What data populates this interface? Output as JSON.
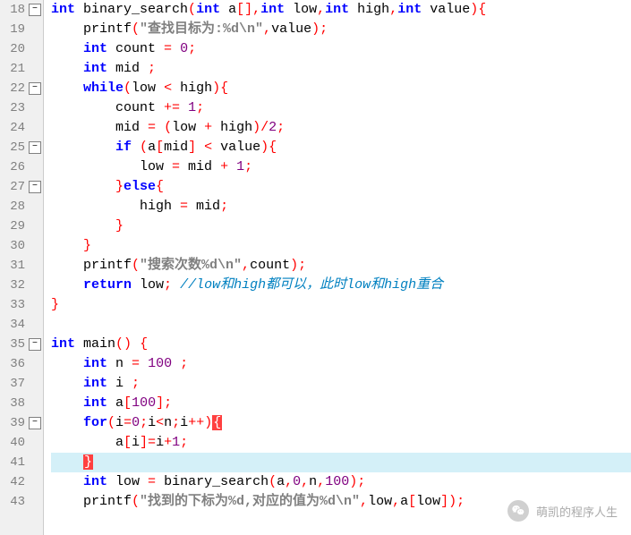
{
  "lines": [
    {
      "n": 18,
      "fold": "minus",
      "hl": false,
      "tokens": [
        [
          "kw",
          "int"
        ],
        [
          "plain",
          " binary_search"
        ],
        [
          "op",
          "("
        ],
        [
          "kw",
          "int"
        ],
        [
          "plain",
          " a"
        ],
        [
          "op",
          "[],"
        ],
        [
          "kw",
          "int"
        ],
        [
          "plain",
          " low"
        ],
        [
          "op",
          ","
        ],
        [
          "kw",
          "int"
        ],
        [
          "plain",
          " high"
        ],
        [
          "op",
          ","
        ],
        [
          "kw",
          "int"
        ],
        [
          "plain",
          " value"
        ],
        [
          "op",
          "){"
        ]
      ]
    },
    {
      "n": 19,
      "fold": "",
      "hl": false,
      "tokens": [
        [
          "plain",
          "    printf"
        ],
        [
          "op",
          "("
        ],
        [
          "str",
          "\"查找目标为:%d\\n\""
        ],
        [
          "op",
          ","
        ],
        [
          "plain",
          "value"
        ],
        [
          "op",
          ");"
        ]
      ]
    },
    {
      "n": 20,
      "fold": "",
      "hl": false,
      "tokens": [
        [
          "plain",
          "    "
        ],
        [
          "kw",
          "int"
        ],
        [
          "plain",
          " count "
        ],
        [
          "op",
          "="
        ],
        [
          "plain",
          " "
        ],
        [
          "num",
          "0"
        ],
        [
          "op",
          ";"
        ]
      ]
    },
    {
      "n": 21,
      "fold": "",
      "hl": false,
      "tokens": [
        [
          "plain",
          "    "
        ],
        [
          "kw",
          "int"
        ],
        [
          "plain",
          " mid "
        ],
        [
          "op",
          ";"
        ]
      ]
    },
    {
      "n": 22,
      "fold": "minus",
      "hl": false,
      "tokens": [
        [
          "plain",
          "    "
        ],
        [
          "kw",
          "while"
        ],
        [
          "op",
          "("
        ],
        [
          "plain",
          "low "
        ],
        [
          "op",
          "<"
        ],
        [
          "plain",
          " high"
        ],
        [
          "op",
          "){"
        ]
      ]
    },
    {
      "n": 23,
      "fold": "",
      "hl": false,
      "tokens": [
        [
          "plain",
          "        count "
        ],
        [
          "op",
          "+="
        ],
        [
          "plain",
          " "
        ],
        [
          "num",
          "1"
        ],
        [
          "op",
          ";"
        ]
      ]
    },
    {
      "n": 24,
      "fold": "",
      "hl": false,
      "tokens": [
        [
          "plain",
          "        mid "
        ],
        [
          "op",
          "="
        ],
        [
          "plain",
          " "
        ],
        [
          "op",
          "("
        ],
        [
          "plain",
          "low "
        ],
        [
          "op",
          "+"
        ],
        [
          "plain",
          " high"
        ],
        [
          "op",
          ")/"
        ],
        [
          "num",
          "2"
        ],
        [
          "op",
          ";"
        ]
      ]
    },
    {
      "n": 25,
      "fold": "minus",
      "hl": false,
      "tokens": [
        [
          "plain",
          "        "
        ],
        [
          "kw",
          "if"
        ],
        [
          "plain",
          " "
        ],
        [
          "op",
          "("
        ],
        [
          "plain",
          "a"
        ],
        [
          "op",
          "["
        ],
        [
          "plain",
          "mid"
        ],
        [
          "op",
          "]"
        ],
        [
          "plain",
          " "
        ],
        [
          "op",
          "<"
        ],
        [
          "plain",
          " value"
        ],
        [
          "op",
          "){"
        ]
      ]
    },
    {
      "n": 26,
      "fold": "",
      "hl": false,
      "tokens": [
        [
          "plain",
          "           low "
        ],
        [
          "op",
          "="
        ],
        [
          "plain",
          " mid "
        ],
        [
          "op",
          "+"
        ],
        [
          "plain",
          " "
        ],
        [
          "num",
          "1"
        ],
        [
          "op",
          ";"
        ]
      ]
    },
    {
      "n": 27,
      "fold": "minus",
      "hl": false,
      "tokens": [
        [
          "plain",
          "        "
        ],
        [
          "op",
          "}"
        ],
        [
          "kw",
          "else"
        ],
        [
          "op",
          "{"
        ]
      ]
    },
    {
      "n": 28,
      "fold": "",
      "hl": false,
      "tokens": [
        [
          "plain",
          "           high "
        ],
        [
          "op",
          "="
        ],
        [
          "plain",
          " mid"
        ],
        [
          "op",
          ";"
        ]
      ]
    },
    {
      "n": 29,
      "fold": "",
      "hl": false,
      "tokens": [
        [
          "plain",
          "        "
        ],
        [
          "op",
          "}"
        ]
      ]
    },
    {
      "n": 30,
      "fold": "",
      "hl": false,
      "tokens": [
        [
          "plain",
          "    "
        ],
        [
          "op",
          "}"
        ]
      ]
    },
    {
      "n": 31,
      "fold": "",
      "hl": false,
      "tokens": [
        [
          "plain",
          "    printf"
        ],
        [
          "op",
          "("
        ],
        [
          "str",
          "\"搜索次数%d\\n\""
        ],
        [
          "op",
          ","
        ],
        [
          "plain",
          "count"
        ],
        [
          "op",
          ");"
        ]
      ]
    },
    {
      "n": 32,
      "fold": "",
      "hl": false,
      "tokens": [
        [
          "plain",
          "    "
        ],
        [
          "kw",
          "return"
        ],
        [
          "plain",
          " low"
        ],
        [
          "op",
          ";"
        ],
        [
          "plain",
          " "
        ],
        [
          "cmt",
          "//low和high都可以，此时low和high重合"
        ]
      ]
    },
    {
      "n": 33,
      "fold": "",
      "hl": false,
      "tokens": [
        [
          "op",
          "}"
        ]
      ]
    },
    {
      "n": 34,
      "fold": "",
      "hl": false,
      "tokens": []
    },
    {
      "n": 35,
      "fold": "minus",
      "hl": false,
      "tokens": [
        [
          "kw",
          "int"
        ],
        [
          "plain",
          " main"
        ],
        [
          "op",
          "()"
        ],
        [
          "plain",
          " "
        ],
        [
          "op",
          "{"
        ]
      ]
    },
    {
      "n": 36,
      "fold": "",
      "hl": false,
      "tokens": [
        [
          "plain",
          "    "
        ],
        [
          "kw",
          "int"
        ],
        [
          "plain",
          " n "
        ],
        [
          "op",
          "="
        ],
        [
          "plain",
          " "
        ],
        [
          "num",
          "100"
        ],
        [
          "plain",
          " "
        ],
        [
          "op",
          ";"
        ]
      ]
    },
    {
      "n": 37,
      "fold": "",
      "hl": false,
      "tokens": [
        [
          "plain",
          "    "
        ],
        [
          "kw",
          "int"
        ],
        [
          "plain",
          " i "
        ],
        [
          "op",
          ";"
        ]
      ]
    },
    {
      "n": 38,
      "fold": "",
      "hl": false,
      "tokens": [
        [
          "plain",
          "    "
        ],
        [
          "kw",
          "int"
        ],
        [
          "plain",
          " a"
        ],
        [
          "op",
          "["
        ],
        [
          "num",
          "100"
        ],
        [
          "op",
          "];"
        ]
      ]
    },
    {
      "n": 39,
      "fold": "minus",
      "hl": false,
      "tokens": [
        [
          "plain",
          "    "
        ],
        [
          "kw",
          "for"
        ],
        [
          "op",
          "("
        ],
        [
          "plain",
          "i"
        ],
        [
          "op",
          "="
        ],
        [
          "num",
          "0"
        ],
        [
          "op",
          ";"
        ],
        [
          "plain",
          "i"
        ],
        [
          "op",
          "<"
        ],
        [
          "plain",
          "n"
        ],
        [
          "op",
          ";"
        ],
        [
          "plain",
          "i"
        ],
        [
          "op",
          "++)"
        ],
        [
          "err",
          "{"
        ]
      ]
    },
    {
      "n": 40,
      "fold": "",
      "hl": false,
      "tokens": [
        [
          "plain",
          "        a"
        ],
        [
          "op",
          "["
        ],
        [
          "plain",
          "i"
        ],
        [
          "op",
          "]="
        ],
        [
          "plain",
          "i"
        ],
        [
          "op",
          "+"
        ],
        [
          "num",
          "1"
        ],
        [
          "op",
          ";"
        ]
      ]
    },
    {
      "n": 41,
      "fold": "",
      "hl": true,
      "tokens": [
        [
          "plain",
          "    "
        ],
        [
          "err",
          "}"
        ]
      ]
    },
    {
      "n": 42,
      "fold": "",
      "hl": false,
      "tokens": [
        [
          "plain",
          "    "
        ],
        [
          "kw",
          "int"
        ],
        [
          "plain",
          " low "
        ],
        [
          "op",
          "="
        ],
        [
          "plain",
          " binary_search"
        ],
        [
          "op",
          "("
        ],
        [
          "plain",
          "a"
        ],
        [
          "op",
          ","
        ],
        [
          "num",
          "0"
        ],
        [
          "op",
          ","
        ],
        [
          "plain",
          "n"
        ],
        [
          "op",
          ","
        ],
        [
          "num",
          "100"
        ],
        [
          "op",
          ");"
        ]
      ]
    },
    {
      "n": 43,
      "fold": "",
      "hl": false,
      "tokens": [
        [
          "plain",
          "    printf"
        ],
        [
          "op",
          "("
        ],
        [
          "str",
          "\"找到的下标为%d,对应的值为%d\\n\""
        ],
        [
          "op",
          ","
        ],
        [
          "plain",
          "low"
        ],
        [
          "op",
          ","
        ],
        [
          "plain",
          "a"
        ],
        [
          "op",
          "["
        ],
        [
          "plain",
          "low"
        ],
        [
          "op",
          "]);"
        ]
      ]
    }
  ],
  "watermark": {
    "text": "萌凯的程序人生"
  }
}
